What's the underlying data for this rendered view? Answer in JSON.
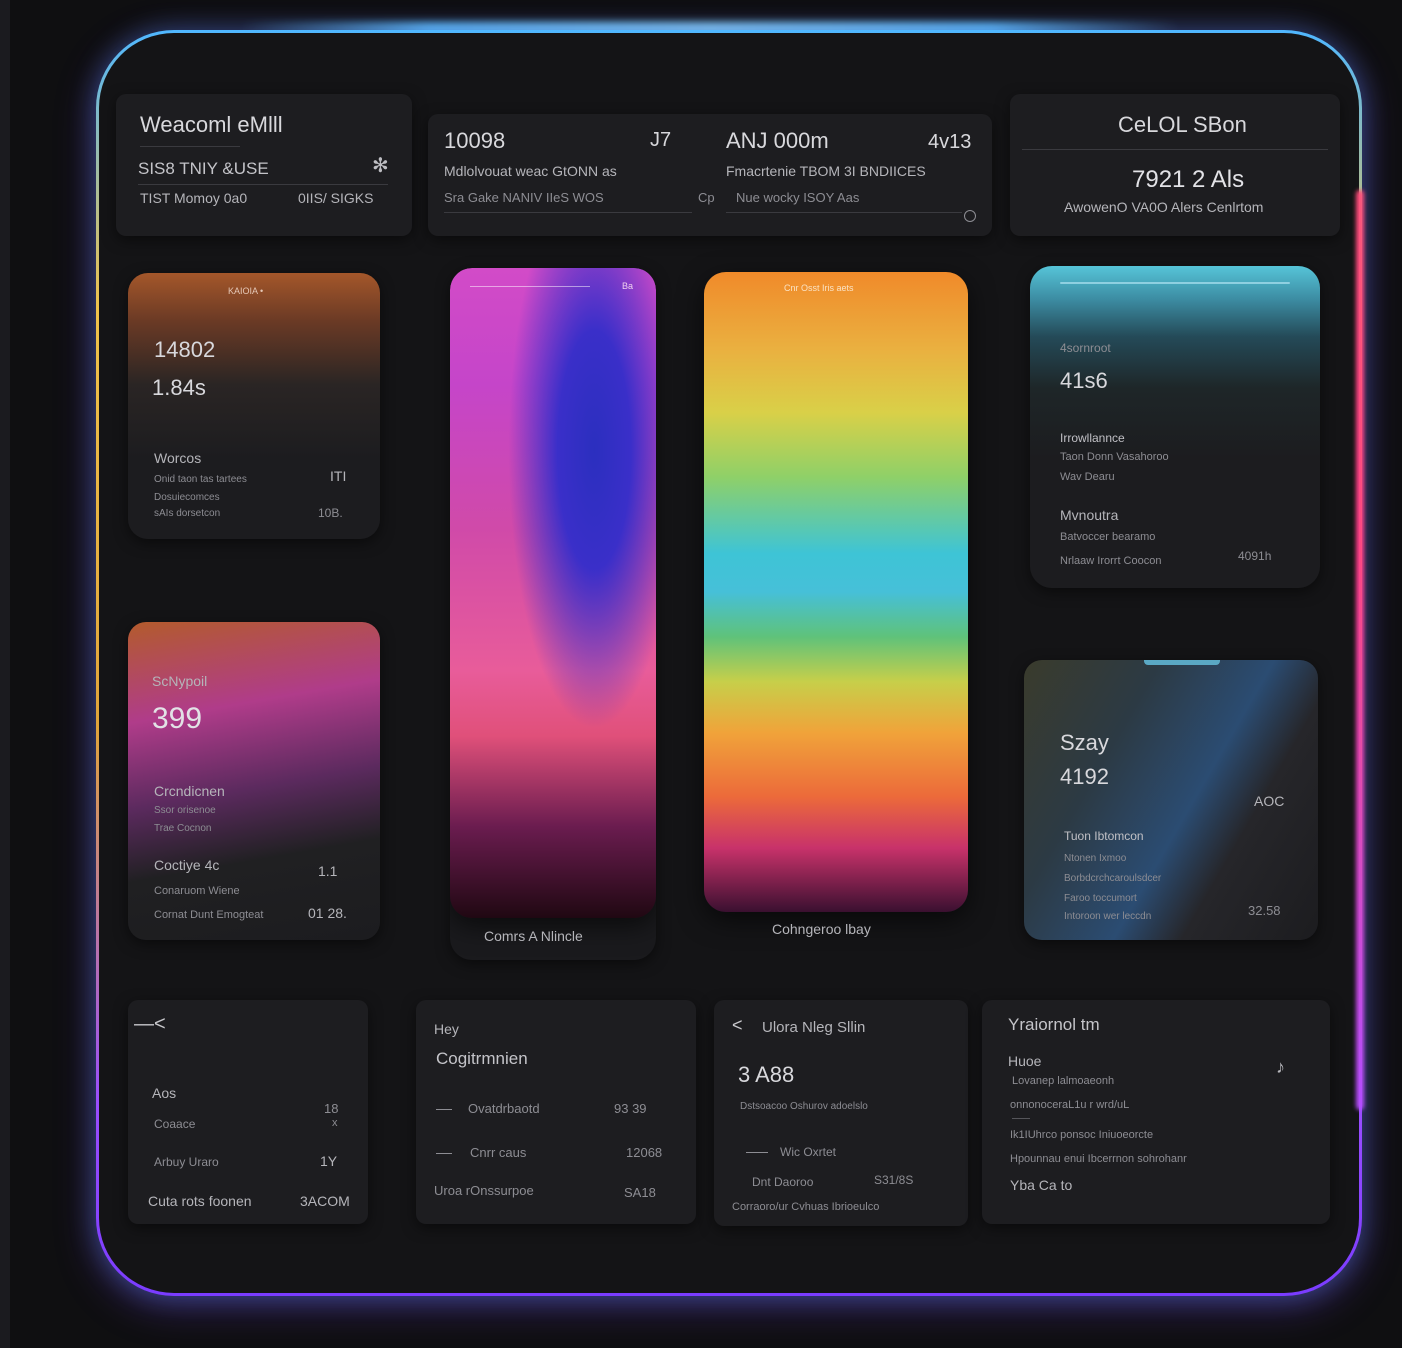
{
  "top_left": {
    "title": "Weacoml eMlll",
    "row1_left": "SIS8  TNIY  &USE",
    "row1_icon": "sparkle-icon",
    "row2_left": "TIST  Momoy  0a0",
    "row2_right": "0IIS/ SIGKS"
  },
  "top_center": {
    "left_value": "10098",
    "left_unit": "J7",
    "left_line1": "Mdlolvouat  weac  GtONN as",
    "left_line2": "Sra Gake  NANIV  IIeS  WOS",
    "right_value": "ANJ 000m",
    "right_unit": "4v13",
    "right_line1": "Fmacrtenie  TBOM 3I BNDIICES",
    "right_line2": "Nue wocky  ISOY  Aas",
    "mid_marker": "Cp",
    "corner_icon": "circle-icon"
  },
  "top_right": {
    "title": "CeLOL SBon",
    "value": "7921 2 Als",
    "caption": "AwowenO VA0O Alers Cenlrtom"
  },
  "card_orange": {
    "header": "KAIOIA  •",
    "value1": "14802",
    "value2": "1.84s",
    "label": "Worcos",
    "line1": "Onid taon tas tartees",
    "line2": "Dosuiecomces",
    "line3": "sAIs dorsetcon",
    "side1": "ITI",
    "side2": "10B."
  },
  "card_magenta": {
    "label": "ScNypoil",
    "value": "399",
    "section": "Crcndicnen",
    "line1": "Ssor orisenoe",
    "line2": "Trae Cocnon",
    "row1_label": "Coctiye 4c",
    "row1_value": "1.1",
    "row2_label": "Conaruom Wiene",
    "row3_label": "Cornat Dunt Emogteat",
    "row3_value": "01 28."
  },
  "tile_purple": {
    "top_label": "Ba",
    "caption": "Comrs A Nlincle"
  },
  "tile_rainbow": {
    "top_label": "Cnr Osst  Iris  aets",
    "caption": "Cohngeroo lbay"
  },
  "card_teal": {
    "label": "4sornroot",
    "value": "41s6",
    "section1": "Irrowllannce",
    "line1": "Taon Donn Vasahoroo",
    "line2": "Wav Dearu",
    "section2": "Mvnoutra",
    "line3": "Batvoccer bearamo",
    "line4": "Nrlaaw Irorrt Coocon",
    "side": "4091h"
  },
  "card_slate": {
    "label1": "Szay",
    "value": "4192",
    "side_top": "AOC",
    "section": "Tuon Ibtomcon",
    "line1": "Ntonen Ixmoo",
    "line2": "Borbdcrchcaroulsdcer",
    "line3": "Faroo toccumort",
    "line4": "Intoroon wer leccdn",
    "side_bottom": "32.58"
  },
  "bottom_1": {
    "icon": "back-arrow-icon",
    "row1_label": "Aos",
    "row1_value": "18",
    "row1_sub": "x",
    "row2_label": "Coaace",
    "row3_label": "Arbuy Uraro",
    "row3_value": "1Y",
    "row4_label": "Cuta rots foonen",
    "row4_value": "3ACOM"
  },
  "bottom_2": {
    "title": "Hey",
    "subtitle": "Cogitrmnien",
    "row1_label": "Ovatdrbaotd",
    "row1_value": "93 39",
    "row2_label": "Cnrr caus",
    "row2_value": "12068",
    "row3_label": "Uroa rOnssurpoe",
    "row3_value": "SA18"
  },
  "bottom_3": {
    "back_icon": "chevron-left-icon",
    "title": "Ulora Nleg Sllin",
    "value": "3 A88",
    "caption": "Dstsoacoo Oshurov adoelslo",
    "row1_label": "Wic Oxrtet",
    "row2_label": "Dnt Daoroo",
    "row2_value": "S31/8S",
    "footer": "Corraoro/ur Cvhuas Ibrioeulco"
  },
  "bottom_4": {
    "title": "Yraiornol tm",
    "label": "Huoe",
    "line1": "Lovanep lalmoaeonh",
    "line2": "onnonoceraL1u  r wrd/uL",
    "line3": "Ik1IUhrco ponsoc Iniuoeorcte",
    "line4": "Hpounnau enui Ibcerrnon sohrohanr",
    "line5": "Yba Ca to",
    "icon": "note-icon"
  }
}
